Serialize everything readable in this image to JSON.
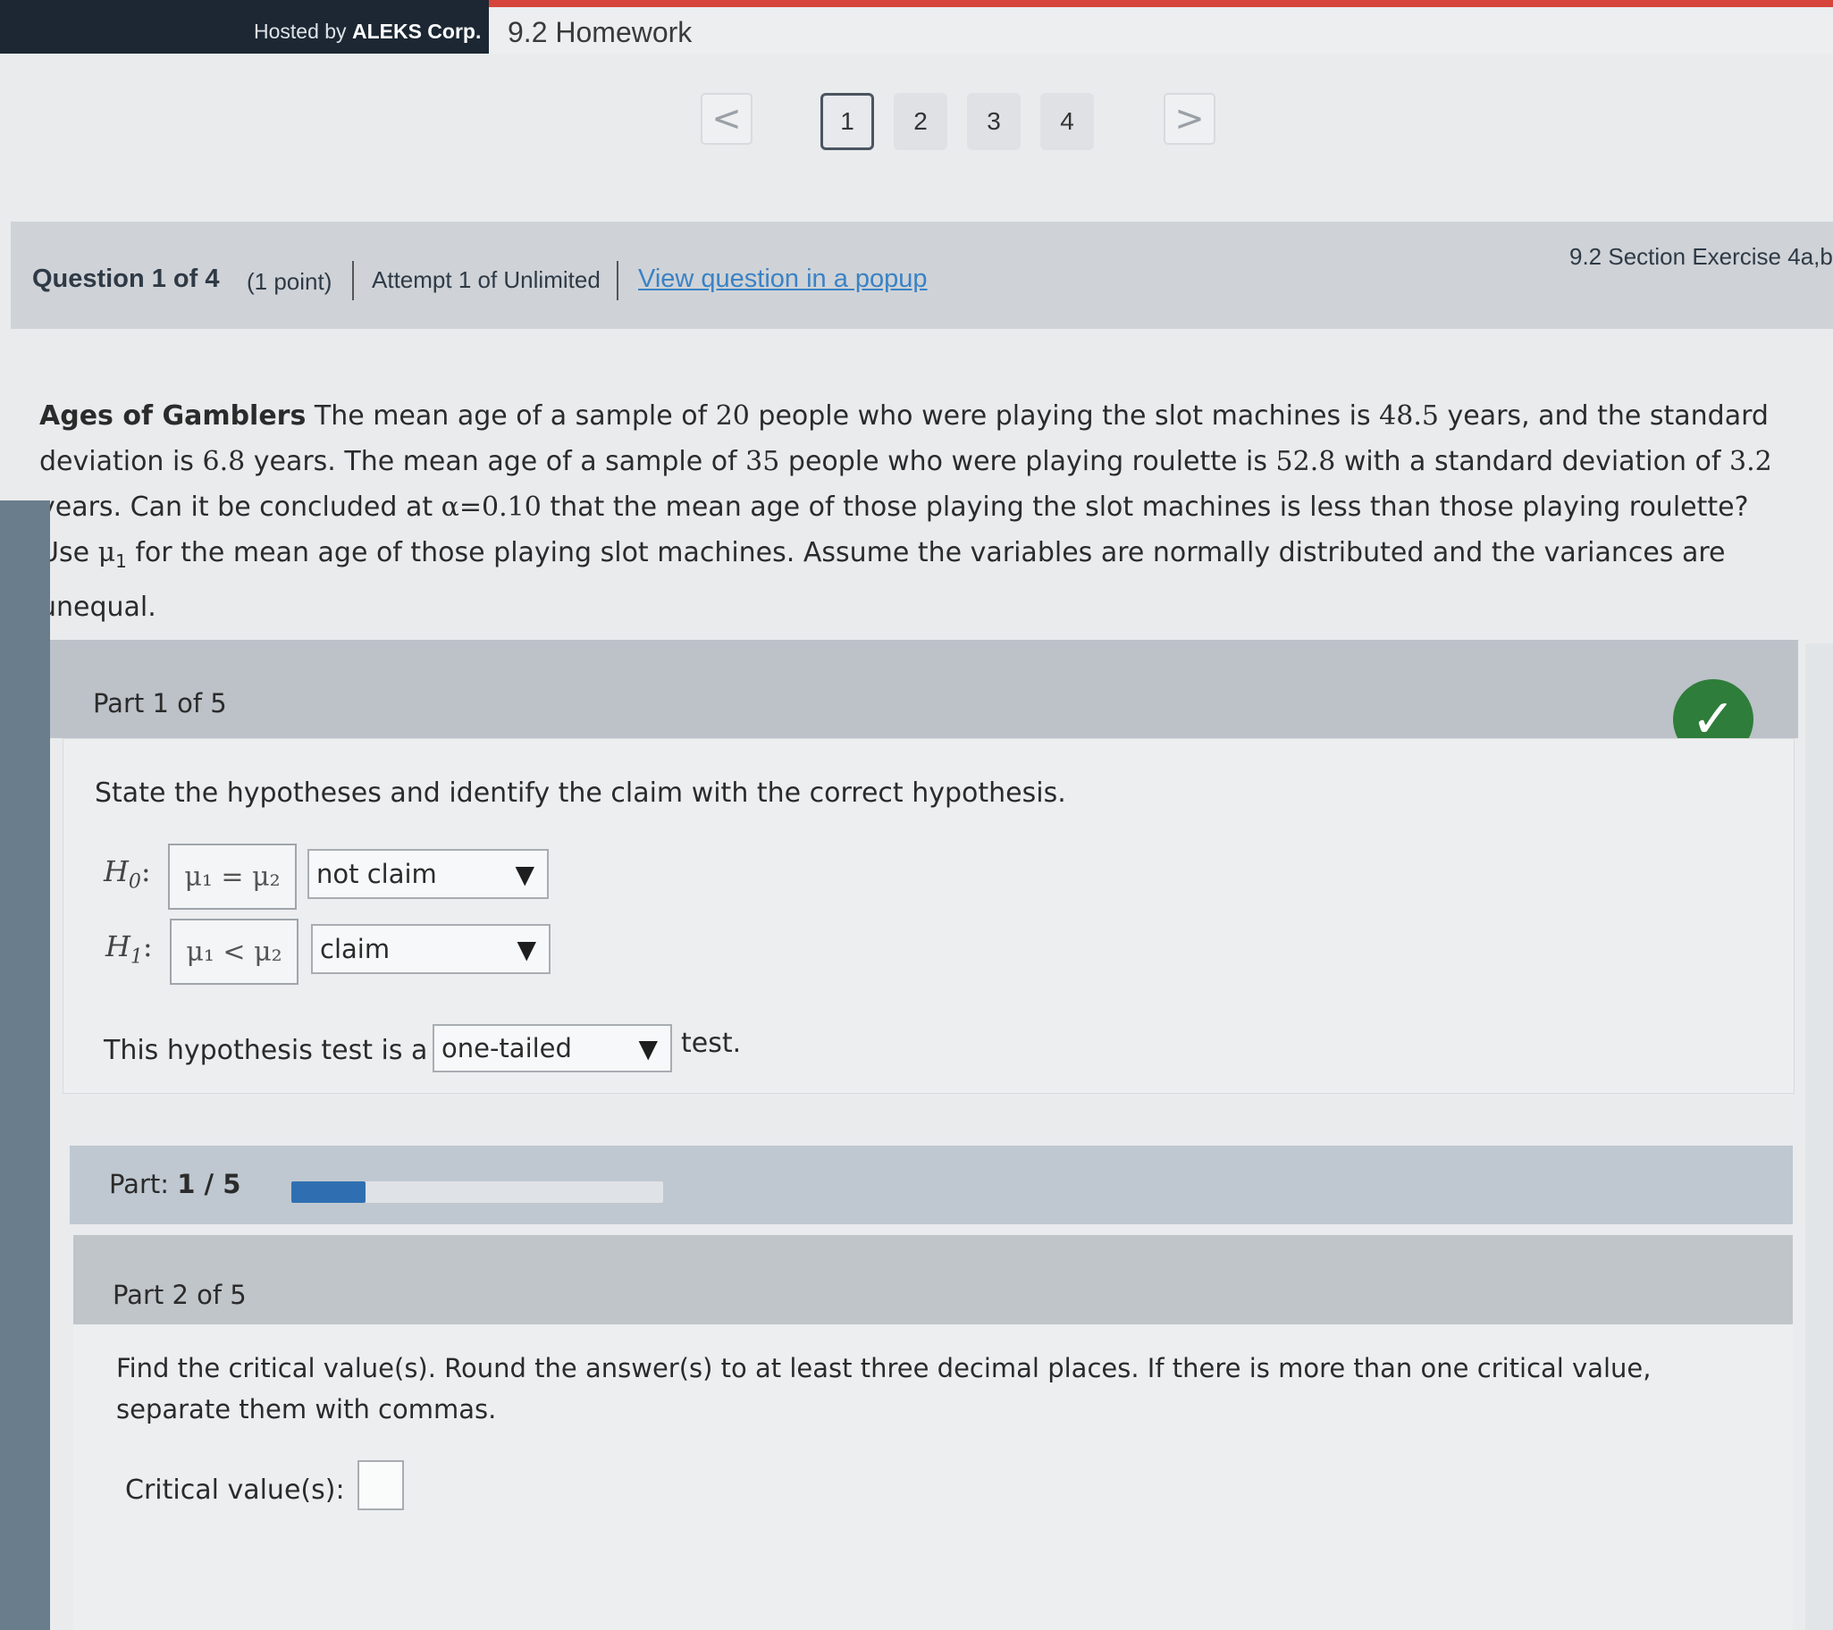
{
  "topbar": {
    "hosted_prefix": "Hosted by ",
    "hosted_brand": "ALEKS Corp.",
    "assignment_title": "9.2 Homework"
  },
  "pagination": {
    "prev_icon": "chevron-left-icon",
    "next_icon": "chevron-right-icon",
    "prev_glyph": "<",
    "next_glyph": ">",
    "pages": [
      "1",
      "2",
      "3",
      "4"
    ],
    "active_page": "1"
  },
  "question_header": {
    "number": "Question 1 of 4",
    "points": "(1 point)",
    "attempt": "Attempt 1 of Unlimited",
    "popup_link": "View question in a popup",
    "section": "9.2 Section Exercise 4a,b"
  },
  "problem": {
    "title": "Ages of Gamblers",
    "t1": " The mean age of a sample of ",
    "n1": "20",
    "t2": " people who were playing the slot machines is ",
    "mean1": "48.5",
    "t3": " years, and the standard deviation is ",
    "sd1": "6.8",
    "t4": " years. The mean age of a sample of ",
    "n2": "35",
    "t5": " people who were playing roulette is ",
    "mean2": "52.8",
    "t6": " with a standard deviation of ",
    "sd2": "3.2",
    "t7": " years. Can it be concluded at ",
    "alpha": "α=0.10",
    "t8": " that the mean age of those playing the slot machines is less than those playing roulette? Use ",
    "mu1": "μ",
    "mu1_sub": "1",
    "t9": " for the mean age of those playing slot machines. Assume the variables are normally distributed and the variances are unequal."
  },
  "part1": {
    "title": "Part 1 of 5",
    "status_icon": "checkmark-icon",
    "status_color": "#2f7d3a",
    "instruction": "State the hypotheses and identify the claim with the correct hypothesis.",
    "h0": {
      "label": "H",
      "sub": "0",
      "colon": ":",
      "expr": "μ₁ = μ₂",
      "select": "not claim"
    },
    "h1": {
      "label": "H",
      "sub": "1",
      "colon": ":",
      "expr": "μ₁ < μ₂",
      "select": "claim"
    },
    "test_prefix": "This hypothesis test is a",
    "test_select": "one-tailed",
    "test_suffix": "test.",
    "dropdown_icon": "triangle-down-icon",
    "dropdown_glyph": "▼"
  },
  "progress": {
    "label": "Part:",
    "value_text": "1 / 5",
    "fraction": 0.2,
    "fill_color": "#2f6fb1"
  },
  "part2": {
    "title": "Part 2 of 5",
    "instruction": "Find the critical value(s). Round the answer(s) to at least three decimal places. If there is more than one critical value, separate them with commas.",
    "input_label": "Critical value(s):",
    "input_value": ""
  }
}
